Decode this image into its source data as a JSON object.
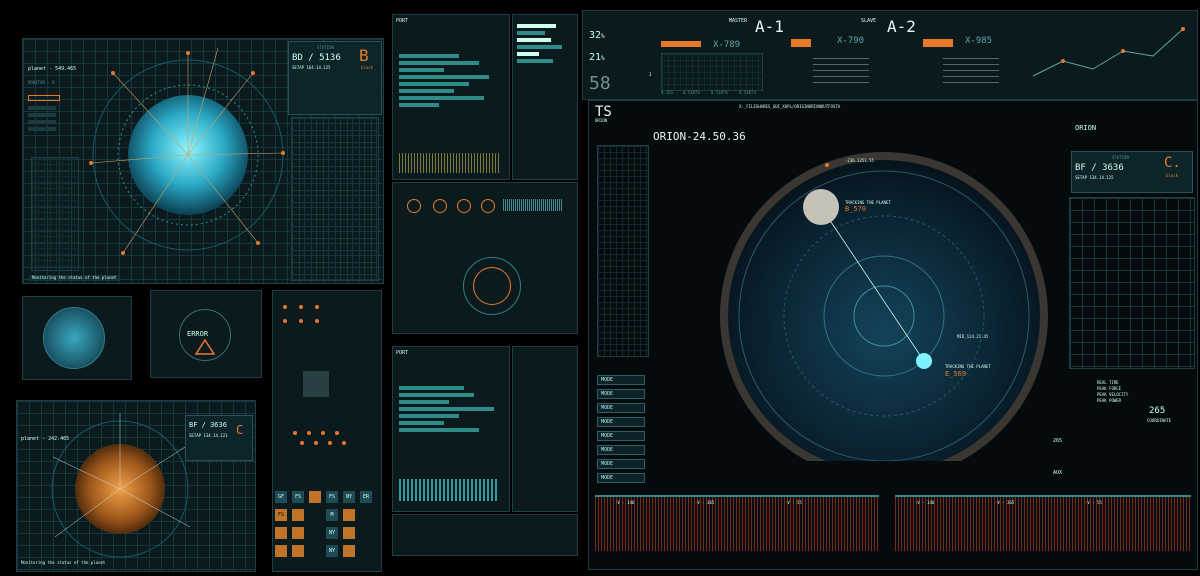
{
  "colors": {
    "accent": "#e8782a",
    "primary": "#3fb8c0",
    "bg": "#000000",
    "panel": "#0a1a1d"
  },
  "panel_a": {
    "title": "planet - 549.465",
    "monitor": "MONITOR - B",
    "station": "STATION",
    "code": "BD / 5136",
    "setap": "SETAP 164.14.125",
    "block_letter": "B",
    "block_word": "block",
    "caption": "Monitoring the status of the planet"
  },
  "panel_error": {
    "label": "ERROR"
  },
  "panel_b": {
    "title": "planet - 242.465",
    "code": "BF / 3636",
    "setap": "SETAP 134.14.123",
    "block_letter": "C",
    "caption": "Monitoring the status of the planet"
  },
  "keypad": {
    "row1": [
      "GF",
      "FS",
      "",
      "FS",
      "NY",
      "ER"
    ],
    "row2": [
      "FS",
      "",
      "M",
      ""
    ],
    "row3": [
      "",
      "",
      "NY",
      ""
    ],
    "row4": [
      "",
      "",
      "NY",
      ""
    ]
  },
  "port_panel": {
    "title": "PORT"
  },
  "top": {
    "pct1": "32",
    "pct2": "21",
    "pct_symbol": "%",
    "big": "58",
    "big_unit": "3",
    "x1": "X-789",
    "x2": "X-790",
    "x3": "X-985",
    "master": "MASTER",
    "slave": "SLAVE",
    "a1": "A-1",
    "a2": "A-2",
    "axis": [
      "0.265",
      "0.54876",
      "0.54876",
      "0.54874"
    ]
  },
  "main": {
    "ts": "TS",
    "orion_small": "ORION",
    "path": "X:_FILESHARES_GUI_XUPL/ORIGINORIONOUTFOSTA",
    "title": "ORION-24.50.36",
    "coord1": "-236.1251.55",
    "track1_label": "TRACKING THE PLANET",
    "track1": "B_570",
    "coord2": "MID_124.21.45",
    "track2_label": "TRACKING THE PLANET",
    "track2": "E_569",
    "modes": [
      "MODE",
      "MODE",
      "MODE",
      "MODE",
      "MODE",
      "MODE",
      "MODE",
      "MODE"
    ],
    "orion_right": "ORION",
    "station": "STATION",
    "code": "BF / 3636",
    "setap": "SETAP 134.14.125",
    "block_letter": "C.",
    "block_word": "block",
    "readouts": [
      "REAL TIME",
      "PEAK FORCE",
      "PEAK VELOCITY",
      "PEAK POWER"
    ],
    "num265": "265",
    "coord_label": "COORDINATE",
    "num265b": "265",
    "aux": "AUX",
    "wave_labels_left": [
      "-V - 146",
      "-V - 365",
      "-V - 55"
    ],
    "wave_labels_right": [
      "-V - 146",
      "-V - 365",
      "-V - 55"
    ]
  }
}
